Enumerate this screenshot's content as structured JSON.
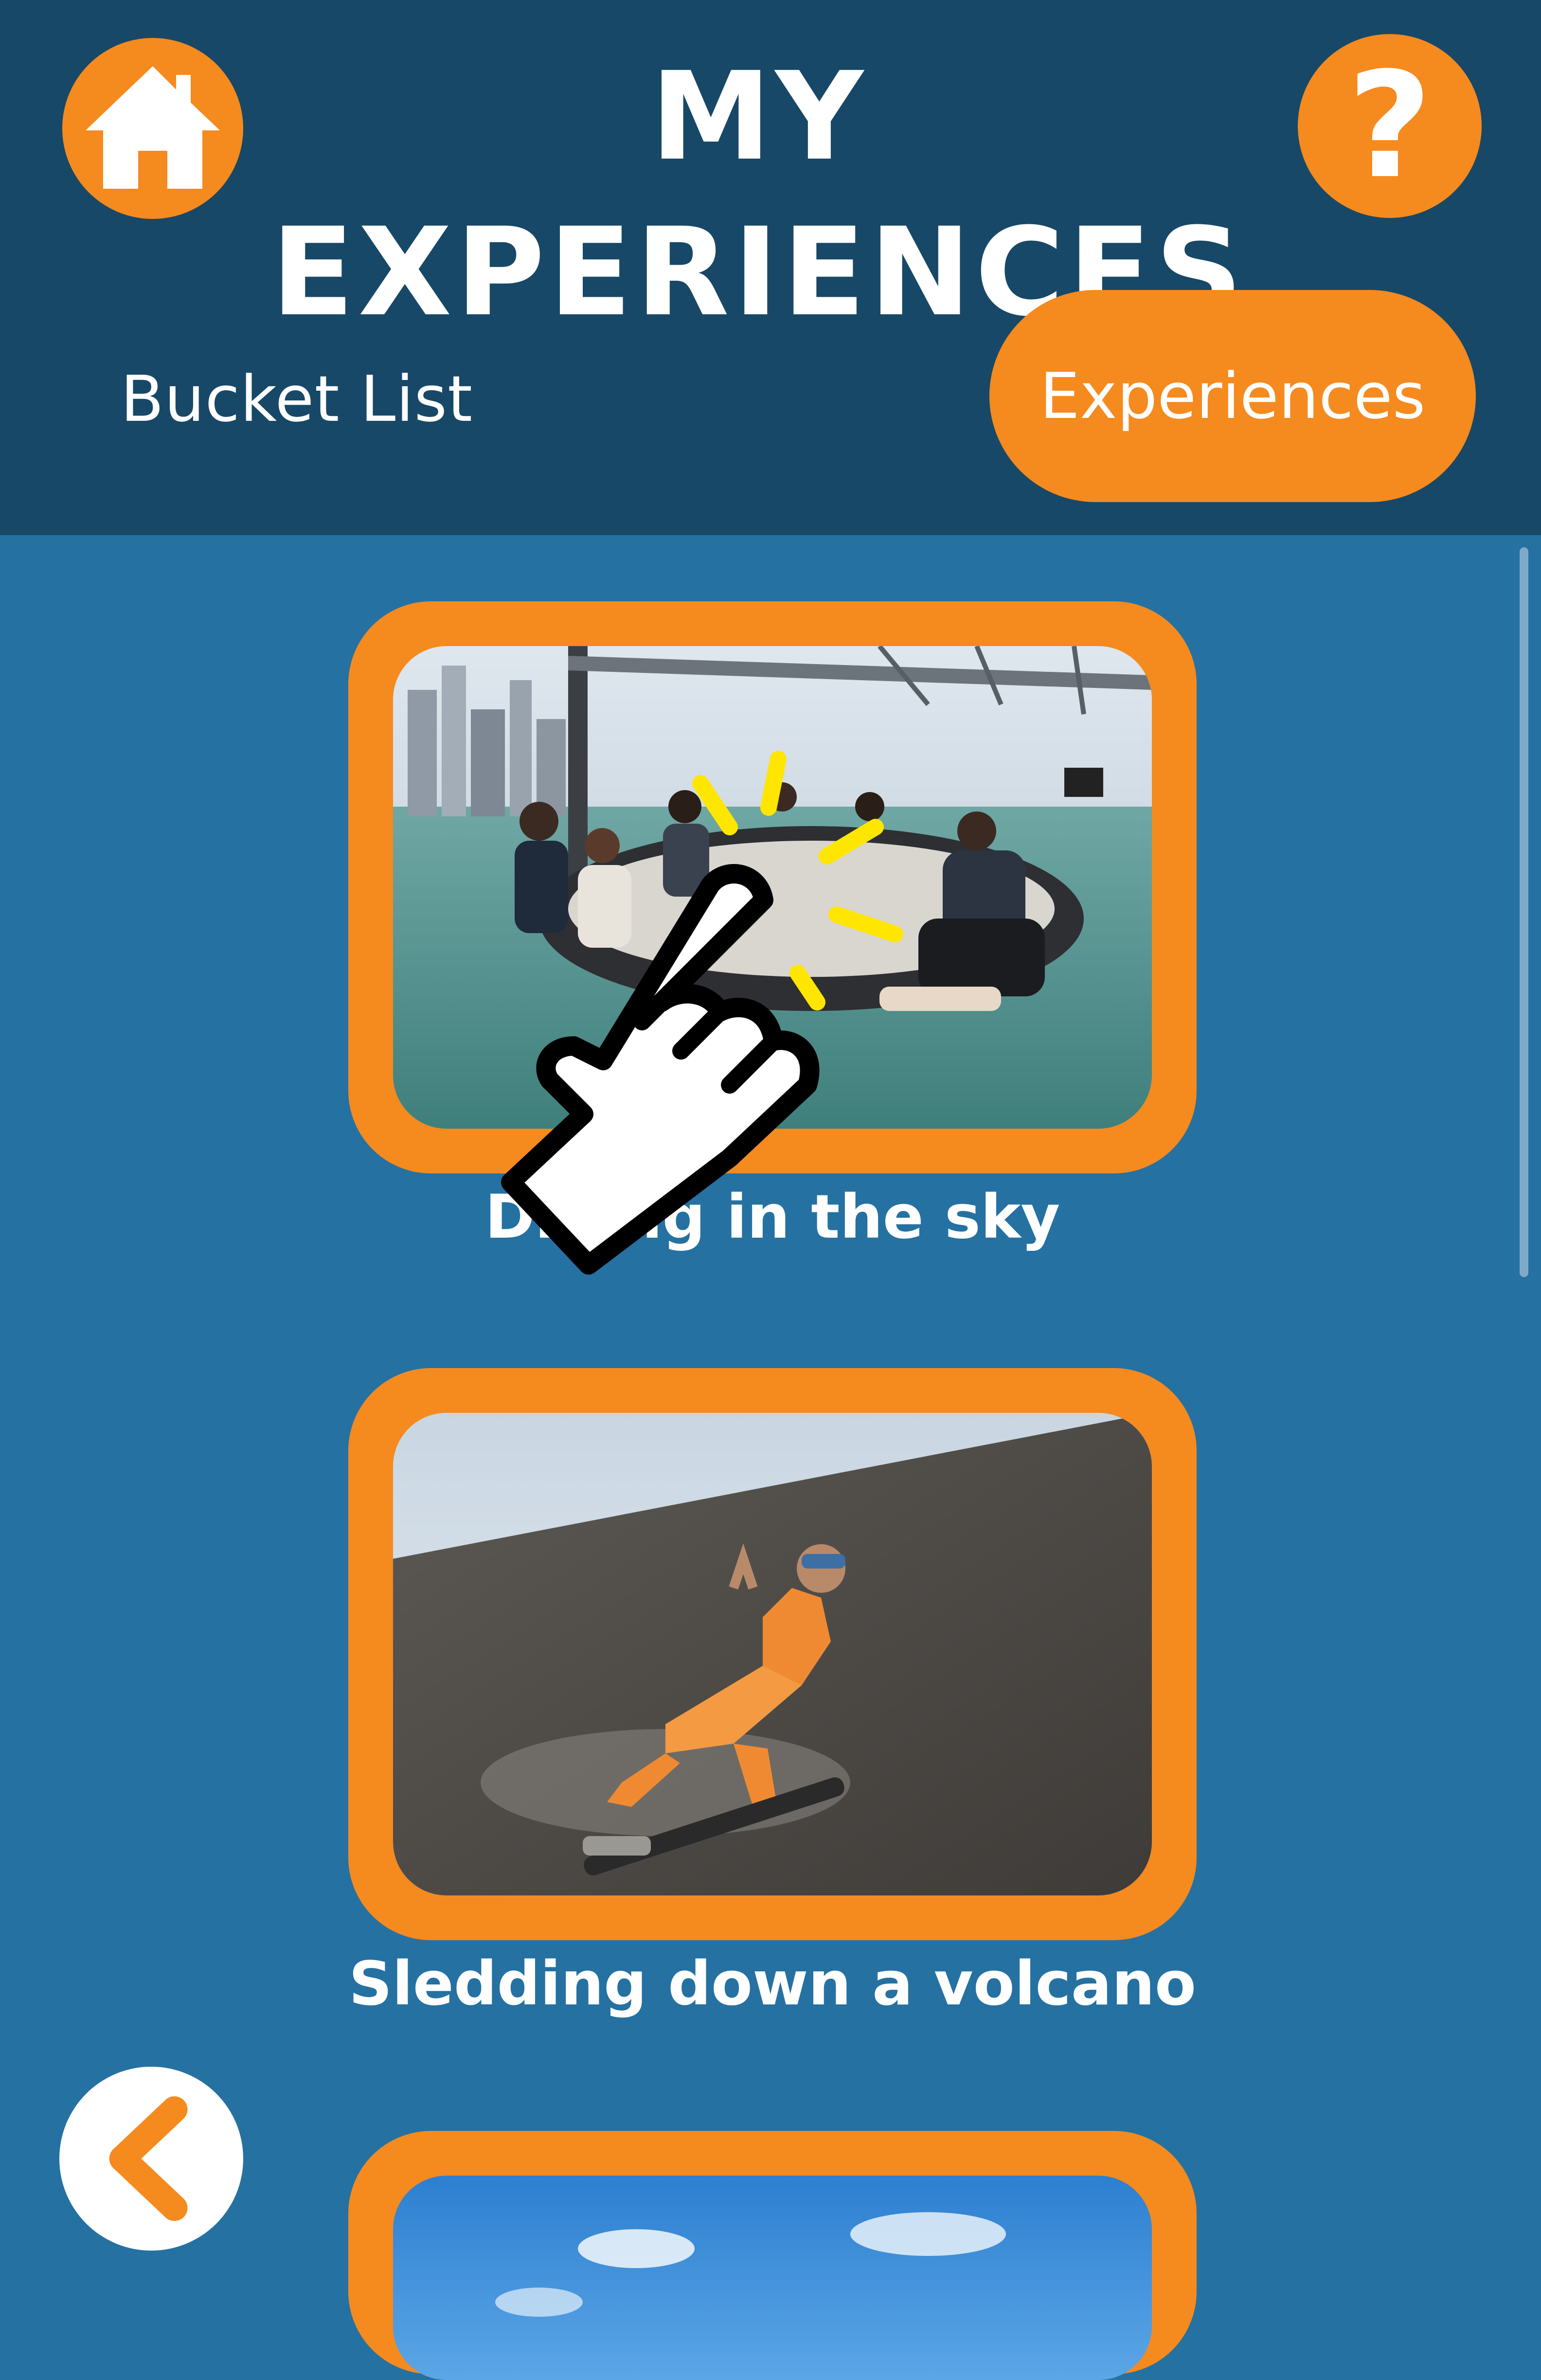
{
  "header": {
    "title": "MY EXPERIENCES",
    "home_icon": "home-icon",
    "help_label": "?",
    "bg_color": "#184867"
  },
  "tabs": [
    {
      "label": "Bucket List",
      "selected": false
    },
    {
      "label": "Experiences",
      "selected": true
    }
  ],
  "experiences": [
    {
      "label": "Dining in the sky"
    },
    {
      "label": "Sledding down a volcano"
    },
    {
      "label": ""
    }
  ],
  "navigation": {
    "back_icon": "chevron-left-icon"
  },
  "overlay": {
    "pointer_icon": "tap-hand-icon"
  },
  "colors": {
    "accent": "#f58a1f",
    "background": "#2571a2",
    "highlight": "#ffe600"
  }
}
